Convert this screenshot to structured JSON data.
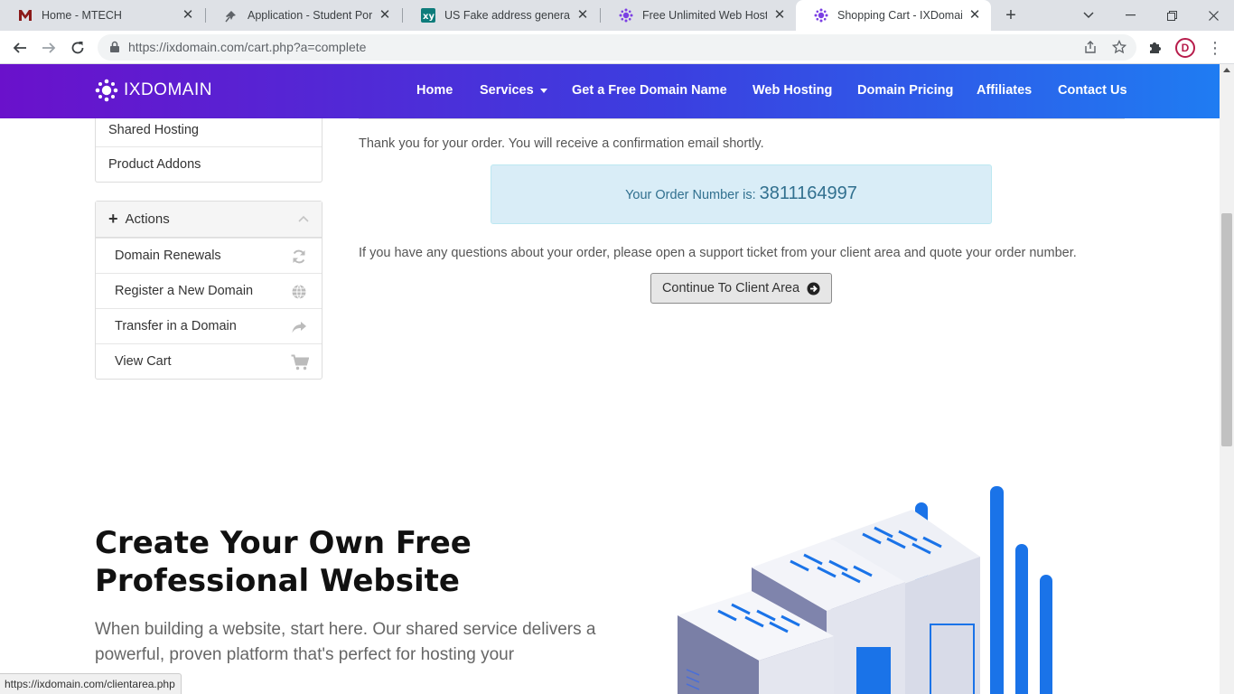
{
  "browser": {
    "tabs": [
      {
        "title": "Home - MTECH",
        "icon": "mtech-logo-icon"
      },
      {
        "title": "Application - Student Portal",
        "icon": "pin-icon"
      },
      {
        "title": "US Fake address generator in",
        "icon": "xy-logo-icon"
      },
      {
        "title": "Free Unlimited Web Hosting",
        "icon": "ixdomain-logo-icon"
      },
      {
        "title": "Shopping Cart - IXDomain -",
        "icon": "ixdomain-logo-icon",
        "active": true
      }
    ],
    "url": "https://ixdomain.com/cart.php?a=complete",
    "status_url": "https://ixdomain.com/clientarea.php"
  },
  "site": {
    "logo_text": "IXDOMAIN",
    "nav": [
      {
        "label": "Home"
      },
      {
        "label": "Services",
        "dropdown": true
      },
      {
        "label": "Get a Free Domain Name"
      },
      {
        "label": "Web Hosting"
      },
      {
        "label": "Domain Pricing"
      },
      {
        "label": "Affiliates"
      },
      {
        "label": "Contact Us"
      }
    ]
  },
  "sidebar": {
    "categories": [
      {
        "label": "Shared Hosting"
      },
      {
        "label": "Product Addons"
      }
    ],
    "actions_title": "Actions",
    "actions": [
      {
        "label": "Domain Renewals",
        "icon": "refresh-icon"
      },
      {
        "label": "Register a New Domain",
        "icon": "globe-icon"
      },
      {
        "label": "Transfer in a Domain",
        "icon": "share-arrow-icon"
      },
      {
        "label": "View Cart",
        "icon": "cart-icon"
      }
    ]
  },
  "order": {
    "thanks": "Thank you for your order. You will receive a confirmation email shortly.",
    "number_label": "Your Order Number is:",
    "number": "3811164997",
    "question": "If you have any questions about your order, please open a support ticket from your client area and quote your order number.",
    "continue_label": "Continue To Client Area"
  },
  "hero": {
    "title_line1": "Create Your Own Free",
    "title_line2": "Professional Website",
    "text": "When building a website, start here. Our shared service delivers a powerful, proven platform that's perfect for hosting your"
  },
  "colors": {
    "header_start": "#6a11cb",
    "header_end": "#1f7cf2",
    "alert_bg": "#d9edf7",
    "alert_text": "#31708f"
  }
}
